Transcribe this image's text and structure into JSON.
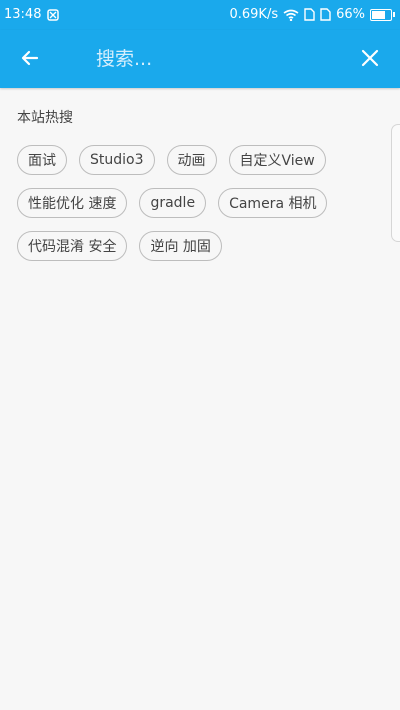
{
  "status_bar": {
    "time": "13:48",
    "network_speed": "0.69K/s",
    "battery_percent": "66%",
    "battery_level": 0.66,
    "icons": [
      "notification-icon",
      "wifi-icon",
      "sim-icon",
      "battery-icon"
    ]
  },
  "toolbar": {
    "search_placeholder": "搜索...",
    "back_icon": "arrow-left-icon",
    "close_icon": "close-icon"
  },
  "hot_search": {
    "title": "本站热搜",
    "rows": [
      [
        "面试",
        "Studio3",
        "动画",
        "自定义View"
      ],
      [
        "性能优化 速度",
        "gradle",
        "Camera 相机"
      ],
      [
        "代码混淆 安全",
        "逆向 加固"
      ]
    ]
  },
  "colors": {
    "accent": "#1aa9ec",
    "background": "#f7f7f7",
    "tag_border": "#bdbdbd",
    "text": "#444444"
  }
}
